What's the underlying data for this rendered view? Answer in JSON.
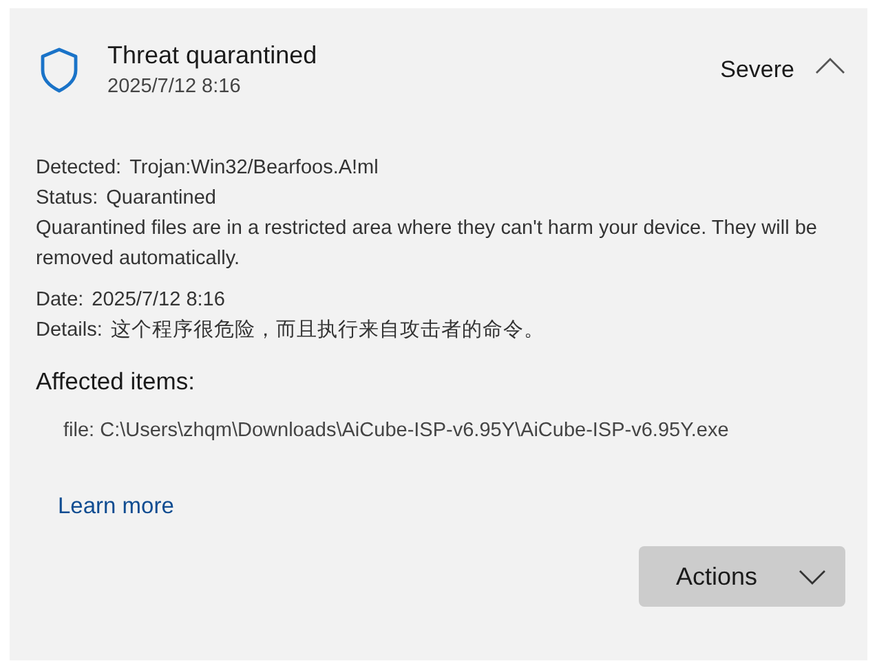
{
  "header": {
    "title": "Threat quarantined",
    "timestamp": "2025/7/12 8:16",
    "severity": "Severe",
    "expanded": true
  },
  "info_rows": [
    {
      "label": "Detected:",
      "value": "Trojan:Win32/Bearfoos.A!ml"
    },
    {
      "label": "Status:",
      "value": "Quarantined"
    }
  ],
  "note": "Quarantined files are in a restricted area where they can't harm your device. They will be removed automatically.",
  "detail_rows": [
    {
      "label": "Date:",
      "value": "2025/7/12 8:16"
    },
    {
      "label": "Details:",
      "value": "这个程序很危险，而且执行来自攻击者的命令。"
    }
  ],
  "affected_items": {
    "heading": "Affected items:",
    "items": [
      "file: C:\\Users\\zhqm\\Downloads\\AiCube-ISP-v6.95Y\\AiCube-ISP-v6.95Y.exe"
    ]
  },
  "link": "Learn more",
  "actions_button": "Actions"
}
